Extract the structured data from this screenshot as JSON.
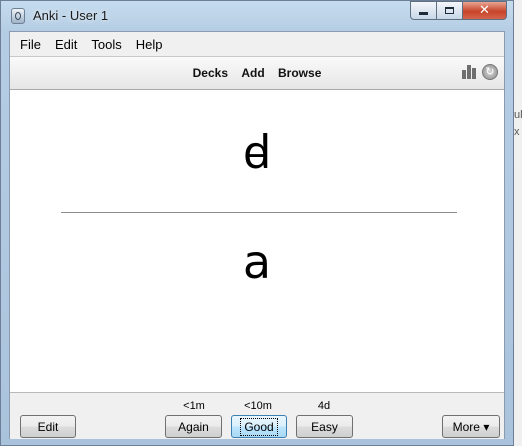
{
  "window": {
    "title": "Anki - User 1"
  },
  "menu": {
    "items": [
      "File",
      "Edit",
      "Tools",
      "Help"
    ]
  },
  "toolbar": {
    "nav": [
      "Decks",
      "Add",
      "Browse"
    ]
  },
  "card": {
    "front": "ꟈ",
    "back": "a"
  },
  "bottom": {
    "edit_label": "Edit",
    "more_label": "More ▾",
    "answers": [
      {
        "interval": "<1m",
        "label": "Again"
      },
      {
        "interval": "<10m",
        "label": "Good"
      },
      {
        "interval": "4d",
        "label": "Easy"
      }
    ]
  },
  "background": {
    "fragments": [
      "ul",
      "x"
    ]
  }
}
